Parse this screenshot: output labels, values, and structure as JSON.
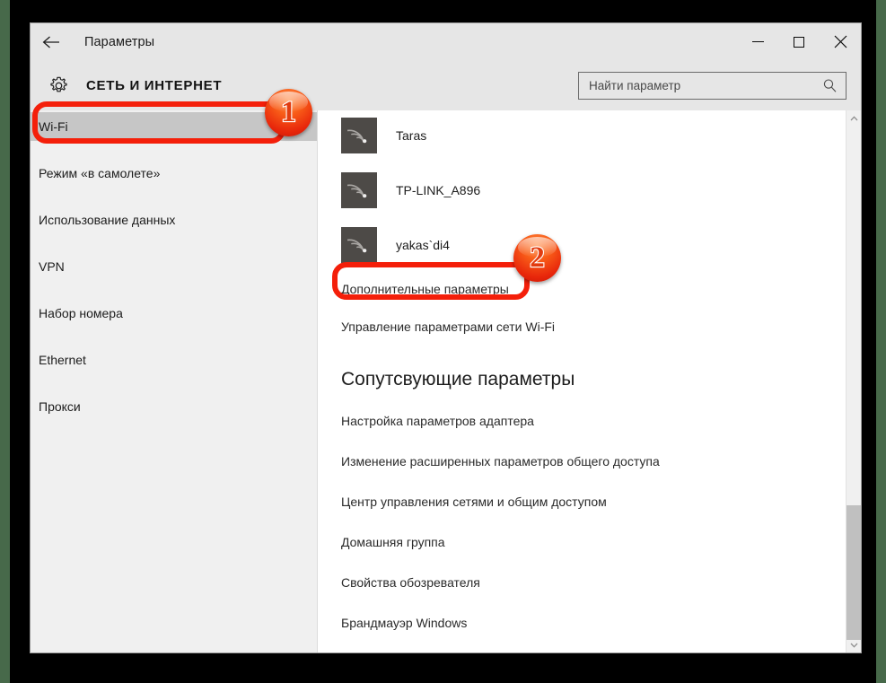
{
  "window": {
    "title": "Параметры",
    "back_icon": "back-arrow-icon",
    "controls": {
      "minimize": "minimize-icon",
      "maximize": "maximize-icon",
      "close": "close-icon"
    }
  },
  "header": {
    "gear_icon": "gear-icon",
    "category": "СЕТЬ И ИНТЕРНЕТ",
    "search": {
      "placeholder": "Найти параметр",
      "value": "",
      "icon": "search-icon"
    }
  },
  "sidebar": {
    "items": [
      {
        "label": "Wi-Fi",
        "selected": true
      },
      {
        "label": "Режим «в самолете»",
        "selected": false
      },
      {
        "label": "Использование данных",
        "selected": false
      },
      {
        "label": "VPN",
        "selected": false
      },
      {
        "label": "Набор номера",
        "selected": false
      },
      {
        "label": "Ethernet",
        "selected": false
      },
      {
        "label": "Прокси",
        "selected": false
      }
    ]
  },
  "main": {
    "networks": [
      {
        "name": "Taras",
        "icon": "wifi-icon"
      },
      {
        "name": "TP-LINK_A896",
        "icon": "wifi-icon"
      },
      {
        "name": "yakas`di4",
        "icon": "wifi-icon"
      }
    ],
    "links": [
      "Дополнительные параметры",
      "Управление параметрами сети Wi-Fi"
    ],
    "related_heading": "Сопутсвующие параметры",
    "related_links": [
      "Настройка параметров адаптера",
      "Изменение расширенных параметров общего доступа",
      "Центр управления сетями и общим доступом",
      "Домашняя группа",
      "Свойства обозревателя",
      "Брандмауэр Windows"
    ]
  },
  "scrollbar": {
    "up_arrow": "chevron-up-icon",
    "down_arrow": "chevron-down-icon"
  },
  "annotations": {
    "badges": [
      {
        "number": "1",
        "target": "Wi-Fi"
      },
      {
        "number": "2",
        "target": "Дополнительные параметры"
      }
    ],
    "highlight_color": "#f41f0a"
  }
}
